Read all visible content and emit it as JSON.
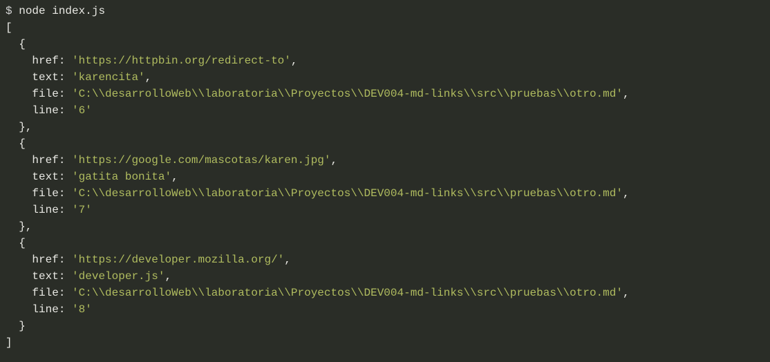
{
  "prompt": "$",
  "command": "node index.js",
  "brackets": {
    "openArr": "[",
    "closeArr": "]",
    "openObj": "{",
    "closeObj": "}",
    "closeObjComma": "},"
  },
  "keys": {
    "href": "href:",
    "text": "text:",
    "file": "file:",
    "line": "line:"
  },
  "items": [
    {
      "href": "'https://httpbin.org/redirect-to'",
      "text": "'karencita'",
      "file": "'C:\\\\desarrolloWeb\\\\laboratoria\\\\Proyectos\\\\DEV004-md-links\\\\src\\\\pruebas\\\\otro.md'",
      "line": "'6'"
    },
    {
      "href": "'https://google.com/mascotas/karen.jpg'",
      "text": "'gatita bonita'",
      "file": "'C:\\\\desarrolloWeb\\\\laboratoria\\\\Proyectos\\\\DEV004-md-links\\\\src\\\\pruebas\\\\otro.md'",
      "line": "'7'"
    },
    {
      "href": "'https://developer.mozilla.org/'",
      "text": "'developer.js'",
      "file": "'C:\\\\desarrolloWeb\\\\laboratoria\\\\Proyectos\\\\DEV004-md-links\\\\src\\\\pruebas\\\\otro.md'",
      "line": "'8'"
    }
  ],
  "comma": ","
}
